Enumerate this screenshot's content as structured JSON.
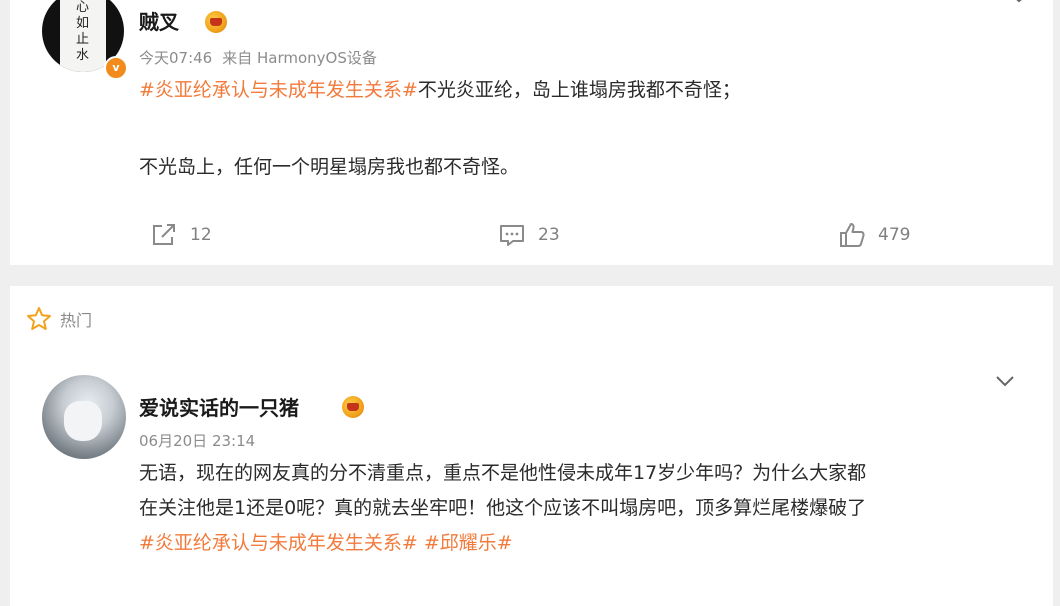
{
  "post": {
    "avatar_text": "心如止水",
    "author": "贼叉",
    "time": "今天07:46",
    "source": "来自 HarmonyOS设备",
    "hashtag": "#炎亚纶承认与未成年发生关系#",
    "line1_rest": "不光炎亚纶，岛上谁塌房我都不奇怪；",
    "line2": "不光岛上，任何一个明星塌房我也都不奇怪。",
    "reposts": "12",
    "comments": "23",
    "likes": "479"
  },
  "hot_section": {
    "label": "热门"
  },
  "comment": {
    "author": "爱说实话的一只猪",
    "time": "06月20日 23:14",
    "line1": "无语，现在的网友真的分不清重点，重点不是他性侵未成年17岁少年吗？为什么大家都",
    "line2": "在关注他是1还是0呢？真的就去坐牢吧！他这个应该不叫塌房吧，顶多算烂尾楼爆破了",
    "hashtag1": "#炎亚纶承认与未成年发生关系#",
    "hashtag2": "#邱耀乐#"
  },
  "colors": {
    "accent": "#f27a3b",
    "meta_gray": "#8c8c8c",
    "background": "#efefef",
    "card": "#ffffff"
  },
  "icons": [
    "repost-icon",
    "comment-icon",
    "like-icon",
    "star-icon",
    "chevron-down-icon",
    "crown-badge-icon",
    "verified-badge-icon"
  ]
}
